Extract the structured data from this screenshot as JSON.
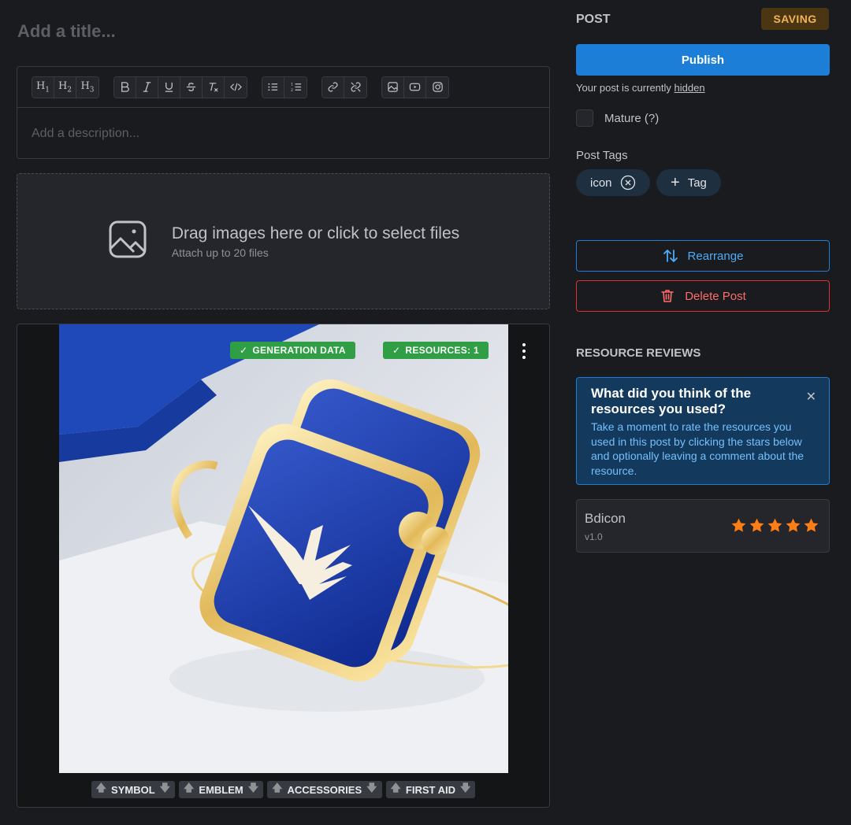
{
  "editor": {
    "title_placeholder": "Add a title...",
    "description_placeholder": "Add a description...",
    "toolbar": {
      "headings": [
        "H1",
        "H2",
        "H3"
      ]
    }
  },
  "dropzone": {
    "main_text": "Drag images here or click to select files",
    "sub_text": "Attach up to 20 files"
  },
  "image": {
    "badges": [
      "GENERATION DATA",
      "RESOURCES: 1"
    ],
    "tags": [
      "SYMBOL",
      "EMBLEM",
      "ACCESSORIES",
      "FIRST AID"
    ]
  },
  "sidebar": {
    "heading": "POST",
    "status_badge": "SAVING",
    "publish_label": "Publish",
    "visibility_text": "Your post is currently",
    "visibility_link": "hidden",
    "mature_label": "Mature (?)",
    "tags_heading": "Post Tags",
    "tags": [
      "icon"
    ],
    "add_tag_label": "Tag",
    "rearrange_label": "Rearrange",
    "delete_label": "Delete Post",
    "reviews_heading": "RESOURCE REVIEWS",
    "alert": {
      "title": "What did you think of the resources you used?",
      "body": "Take a moment to rate the resources you used in this post by clicking the stars below and optionally leaving a comment about the resource."
    },
    "resource": {
      "name": "Bdicon",
      "version": "v1.0",
      "rating": 5,
      "max_rating": 5
    }
  },
  "colors": {
    "accent": "#1c7ed6",
    "danger": "#e03131",
    "success": "#2f9e44",
    "warning": "#f0b357",
    "star": "#fd7e14"
  }
}
